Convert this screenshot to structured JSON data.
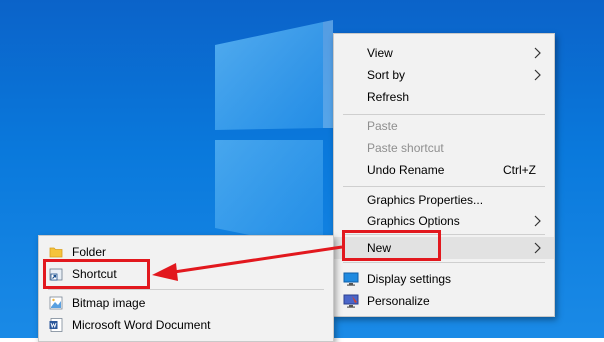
{
  "desktop": {
    "background_color": "#0a79dc",
    "logo": "windows-logo"
  },
  "context_menu": {
    "items": [
      {
        "label": "View",
        "submenu": true
      },
      {
        "label": "Sort by",
        "submenu": true
      },
      {
        "label": "Refresh"
      },
      {
        "label": "Paste",
        "disabled": true
      },
      {
        "label": "Paste shortcut",
        "disabled": true
      },
      {
        "label": "Undo Rename",
        "shortcut": "Ctrl+Z"
      },
      {
        "label": "Graphics Properties..."
      },
      {
        "label": "Graphics Options",
        "submenu": true
      },
      {
        "label": "New",
        "submenu": true,
        "highlighted": true
      },
      {
        "label": "Display settings",
        "icon": "display-icon"
      },
      {
        "label": "Personalize",
        "icon": "personalize-icon"
      }
    ]
  },
  "new_submenu": {
    "items": [
      {
        "label": "Folder",
        "icon": "folder-icon"
      },
      {
        "label": "Shortcut",
        "icon": "shortcut-icon",
        "highlighted": true
      },
      {
        "label": "Bitmap image",
        "icon": "bitmap-icon"
      },
      {
        "label": "Microsoft Word Document",
        "icon": "word-document-icon"
      }
    ]
  },
  "annotation": {
    "color": "#e2181e"
  }
}
